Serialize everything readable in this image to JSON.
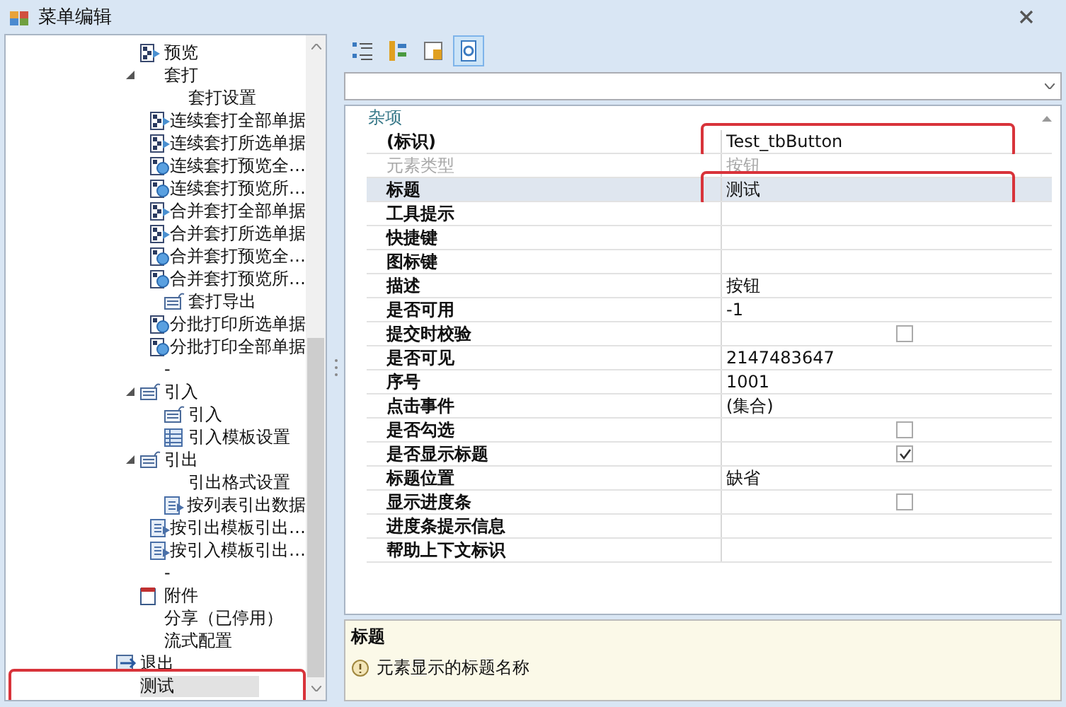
{
  "window": {
    "title": "菜单编辑"
  },
  "tree": {
    "items": [
      {
        "label": "预览",
        "kind": "doc-grid",
        "selected": false
      },
      {
        "label": "套打",
        "expanded": true,
        "selected": false,
        "children": [
          {
            "label": "套打设置",
            "selected": false
          },
          {
            "label": "连续套打全部单据",
            "kind": "doc-grid",
            "selected": false
          },
          {
            "label": "连续套打所选单据",
            "kind": "doc-grid",
            "selected": false
          },
          {
            "label": "连续套打预览全…",
            "kind": "doc-globe",
            "selected": false
          },
          {
            "label": "连续套打预览所…",
            "kind": "doc-globe",
            "selected": false
          },
          {
            "label": "合并套打全部单据",
            "kind": "doc-grid",
            "selected": false
          },
          {
            "label": "合并套打所选单据",
            "kind": "doc-grid",
            "selected": false
          },
          {
            "label": "合并套打预览全…",
            "kind": "doc-globe",
            "selected": false
          },
          {
            "label": "合并套打预览所…",
            "kind": "doc-globe",
            "selected": false
          },
          {
            "label": "套打导出",
            "kind": "folder-arrow",
            "selected": false
          },
          {
            "label": "分批打印所选单据",
            "kind": "doc-globe",
            "selected": false
          },
          {
            "label": "分批打印全部单据",
            "kind": "doc-globe",
            "selected": false
          }
        ]
      },
      {
        "label": "-",
        "selected": false
      },
      {
        "label": "引入",
        "kind": "folder-arrow",
        "expanded": true,
        "selected": false,
        "children": [
          {
            "label": "引入",
            "kind": "folder-arrow",
            "selected": false
          },
          {
            "label": "引入模板设置",
            "kind": "table",
            "selected": false
          }
        ]
      },
      {
        "label": "引出",
        "kind": "folder-arrow",
        "expanded": true,
        "selected": false,
        "children": [
          {
            "label": "引出格式设置",
            "selected": false
          },
          {
            "label": "按列表引出数据",
            "kind": "doc-export",
            "selected": false
          },
          {
            "label": "按引出模板引出…",
            "kind": "doc-export",
            "selected": false
          },
          {
            "label": "按引入模板引出…",
            "kind": "doc-export",
            "selected": false
          }
        ]
      },
      {
        "label": "-",
        "selected": false
      },
      {
        "label": "附件",
        "kind": "page",
        "selected": false
      },
      {
        "label": "分享（已停用）",
        "selected": false
      },
      {
        "label": "流式配置",
        "selected": false
      }
    ],
    "outer_items": [
      {
        "label": "退出",
        "kind": "exit",
        "selected": false,
        "highlighted": false
      },
      {
        "label": "测试",
        "selected": true,
        "highlighted": true
      }
    ]
  },
  "toolbar": [
    {
      "kind": "categorized",
      "selected": false
    },
    {
      "kind": "alphabetical",
      "selected": false
    },
    {
      "kind": "property-pages",
      "selected": false
    },
    {
      "kind": "help",
      "selected": true
    }
  ],
  "property_grid": {
    "category": "杂项",
    "rows": [
      {
        "name": "(标识)",
        "kind": "text",
        "value": "Test_tbButton",
        "disabled": false,
        "selected": false,
        "highlighted": true
      },
      {
        "name": "元素类型",
        "kind": "text",
        "value": "按钮",
        "disabled": true,
        "selected": false,
        "highlighted": false
      },
      {
        "name": "标题",
        "kind": "text",
        "value": "测试",
        "disabled": false,
        "selected": true,
        "highlighted": true
      },
      {
        "name": "工具提示",
        "kind": "empty",
        "disabled": false,
        "selected": false,
        "highlighted": false
      },
      {
        "name": "快捷键",
        "kind": "empty",
        "disabled": false,
        "selected": false,
        "highlighted": false
      },
      {
        "name": "图标键",
        "kind": "empty",
        "disabled": false,
        "selected": false,
        "highlighted": false
      },
      {
        "name": "描述",
        "kind": "text",
        "value": "按钮",
        "disabled": false,
        "selected": false,
        "highlighted": false
      },
      {
        "name": "是否可用",
        "kind": "text",
        "value": "-1",
        "disabled": false,
        "selected": false,
        "highlighted": false
      },
      {
        "name": "提交时校验",
        "kind": "checkbox",
        "checked": false,
        "disabled": false,
        "selected": false,
        "highlighted": false
      },
      {
        "name": "是否可见",
        "kind": "text",
        "value": "2147483647",
        "disabled": false,
        "selected": false,
        "highlighted": false
      },
      {
        "name": "序号",
        "kind": "text",
        "value": "1001",
        "disabled": false,
        "selected": false,
        "highlighted": false
      },
      {
        "name": "点击事件",
        "kind": "text",
        "value": "(集合)",
        "disabled": false,
        "selected": false,
        "highlighted": false
      },
      {
        "name": "是否勾选",
        "kind": "checkbox",
        "checked": false,
        "disabled": false,
        "selected": false,
        "highlighted": false
      },
      {
        "name": "是否显示标题",
        "kind": "checkbox",
        "checked": true,
        "disabled": false,
        "selected": false,
        "highlighted": false
      },
      {
        "name": "标题位置",
        "kind": "text",
        "value": "缺省",
        "disabled": false,
        "selected": false,
        "highlighted": false
      },
      {
        "name": "显示进度条",
        "kind": "checkbox",
        "checked": false,
        "disabled": false,
        "selected": false,
        "highlighted": false
      },
      {
        "name": "进度条提示信息",
        "kind": "empty",
        "disabled": false,
        "selected": false,
        "highlighted": false
      },
      {
        "name": "帮助上下文标识",
        "kind": "empty",
        "disabled": false,
        "selected": false,
        "highlighted": false
      }
    ]
  },
  "description": {
    "title": "标题",
    "text": "元素显示的标题名称"
  }
}
